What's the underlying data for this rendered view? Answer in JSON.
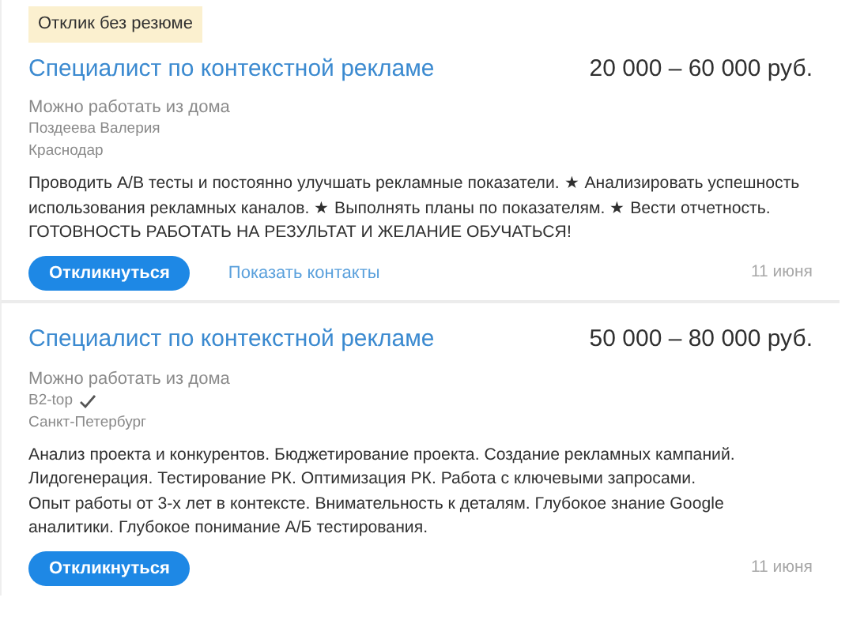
{
  "vacancies": [
    {
      "badge": "Отклик без резюме",
      "title": "Специалист по контекстной рекламе",
      "salary": "20 000 – 60 000 руб.",
      "remote": "Можно работать из дома",
      "company": "Поздеева Валерия",
      "verified": false,
      "city": "Краснодар",
      "description": [
        "Проводить A/B тесты и постоянно улучшать рекламные показатели. ★ Анализировать успешность использования рекламных каналов. ★ Выполнять планы по показателям. ★ Вести отчетность.",
        "ГОТОВНОСТЬ РАБОТАТЬ НА РЕЗУЛЬТАТ И ЖЕЛАНИЕ ОБУЧАТЬСЯ!"
      ],
      "respond": "Откликнуться",
      "contacts": "Показать контакты",
      "date": "11 июня"
    },
    {
      "title": "Специалист по контекстной рекламе",
      "salary": "50 000 – 80 000 руб.",
      "remote": "Можно работать из дома",
      "company": "B2-top",
      "verified": true,
      "city": "Санкт-Петербург",
      "description": [
        "Анализ проекта и конкурентов. Бюджетирование проекта. Создание рекламных кампаний. Лидогенерация. Тестирование РК. Оптимизация РК. Работа с ключевыми запросами.",
        "Опыт работы от 3-х лет в контексте. Внимательность к деталям. Глубокое знание Google аналитики. Глубокое понимание А/Б тестирования."
      ],
      "respond": "Откликнуться",
      "date": "11 июня"
    }
  ]
}
